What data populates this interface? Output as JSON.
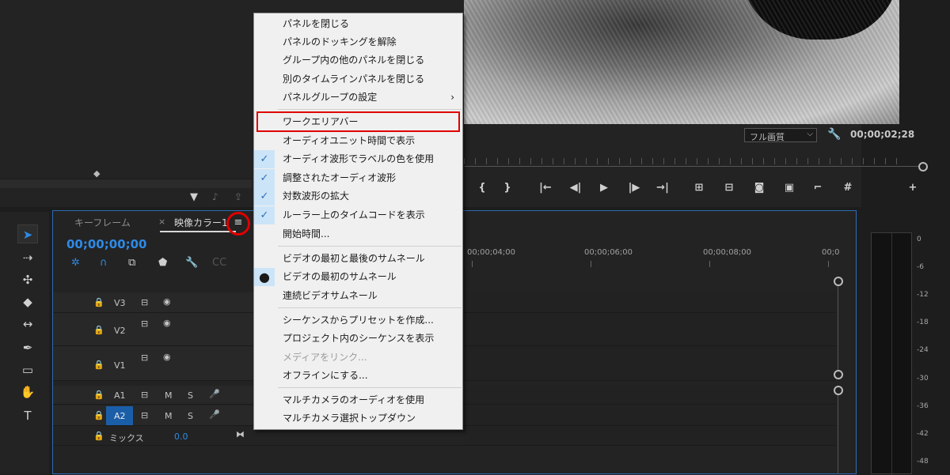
{
  "source": {},
  "program": {
    "quality": "フル画質",
    "timecode": "00;00;02;28"
  },
  "timeline": {
    "tab_keyframe": "キーフレーム",
    "tab_close": "×",
    "tab_sequence": "映像カラー1",
    "panel_menu_icon": "≡",
    "current_timecode": "00;00;00;00",
    "ruler": [
      "00;00;04;00",
      "00;00;06;00",
      "00;00;08;00",
      "00;0"
    ],
    "tracks": [
      {
        "name": "V3"
      },
      {
        "name": "V2"
      },
      {
        "name": "V1"
      },
      {
        "name": "A1",
        "m": "M",
        "s": "S"
      },
      {
        "name": "A2",
        "m": "M",
        "s": "S"
      }
    ],
    "mix_label": "ミックス",
    "mix_value": "0.0"
  },
  "meter": {
    "labels": [
      "0",
      "-6",
      "-12",
      "-18",
      "-24",
      "-30",
      "-36",
      "-42",
      "-48"
    ]
  },
  "menu": {
    "items": [
      {
        "label": "パネルを閉じる"
      },
      {
        "label": "パネルのドッキングを解除"
      },
      {
        "label": "グループ内の他のパネルを閉じる"
      },
      {
        "label": "別のタイムラインパネルを閉じる"
      },
      {
        "label": "パネルグループの設定",
        "submenu": "›"
      },
      {
        "label": "ワークエリアバー"
      },
      {
        "label": "オーディオユニット時間で表示"
      },
      {
        "label": "オーディオ波形でラベルの色を使用",
        "check": "✓"
      },
      {
        "label": "調整されたオーディオ波形",
        "check": "✓"
      },
      {
        "label": "対数波形の拡大",
        "check": "✓"
      },
      {
        "label": "ルーラー上のタイムコードを表示",
        "check": "✓"
      },
      {
        "label": "開始時間..."
      },
      {
        "label": "ビデオの最初と最後のサムネール"
      },
      {
        "label": "ビデオの最初のサムネール",
        "check": "●"
      },
      {
        "label": "連続ビデオサムネール"
      },
      {
        "label": "シーケンスからプリセットを作成..."
      },
      {
        "label": "プロジェクト内のシーケンスを表示"
      },
      {
        "label": "メディアをリンク..."
      },
      {
        "label": "オフラインにする..."
      },
      {
        "label": "マルチカメラのオーディオを使用"
      },
      {
        "label": "マルチカメラ選択トップダウン"
      }
    ]
  }
}
